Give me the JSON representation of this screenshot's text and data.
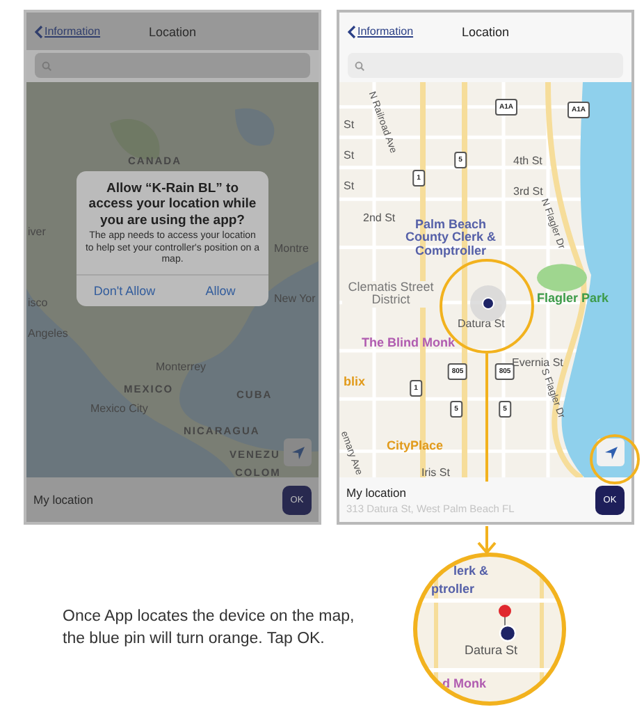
{
  "phones": [
    {
      "back_link": "Information",
      "title": "Location",
      "kind": "world",
      "map_labels": [
        {
          "text": "CANADA",
          "kind": "country"
        },
        {
          "text": "Montre",
          "kind": "city"
        },
        {
          "text": "New Yor",
          "kind": "city"
        },
        {
          "text": "iver",
          "kind": "city"
        },
        {
          "text": "isco",
          "kind": "city"
        },
        {
          "text": "Angeles",
          "kind": "city"
        },
        {
          "text": "Monterrey",
          "kind": "city"
        },
        {
          "text": "MEXICO",
          "kind": "country"
        },
        {
          "text": "Mexico City",
          "kind": "city"
        },
        {
          "text": "CUBA",
          "kind": "country"
        },
        {
          "text": "NICARAGUA",
          "kind": "country"
        },
        {
          "text": "VENEZU",
          "kind": "country"
        },
        {
          "text": "COLOM",
          "kind": "country"
        }
      ],
      "dialog": {
        "title": "Allow “K-Rain BL” to access your location while you are using the app?",
        "message": "The app needs to access your location to help set your controller's position on a map.",
        "buttons": [
          "Don't Allow",
          "Allow"
        ]
      },
      "footer": {
        "label": "My location",
        "ok": "OK"
      }
    },
    {
      "back_link": "Information",
      "title": "Location",
      "kind": "streets",
      "map_labels": [
        {
          "text": "N Railroad Ave",
          "kind": "street-vertical"
        },
        {
          "text": "St",
          "kind": "street"
        },
        {
          "text": "St",
          "kind": "street"
        },
        {
          "text": "St",
          "kind": "street"
        },
        {
          "text": "4th St",
          "kind": "street"
        },
        {
          "text": "3rd St",
          "kind": "street"
        },
        {
          "text": "2nd St",
          "kind": "street"
        },
        {
          "text": "N Flagler Dr",
          "kind": "street-vertical"
        },
        {
          "text": "Palm Beach County Clerk & Comptroller",
          "kind": "civic"
        },
        {
          "text": "Clematis Street District",
          "kind": "district"
        },
        {
          "text": "Flagler Park",
          "kind": "park"
        },
        {
          "text": "Datura St",
          "kind": "street"
        },
        {
          "text": "The Blind Monk",
          "kind": "food"
        },
        {
          "text": "Evernia St",
          "kind": "street"
        },
        {
          "text": "S Flagler Dr",
          "kind": "street-vertical"
        },
        {
          "text": "blix",
          "kind": "shop"
        },
        {
          "text": "CityPlace",
          "kind": "shop"
        },
        {
          "text": "Iris St",
          "kind": "street"
        },
        {
          "text": "emary Ave",
          "kind": "street-vertical"
        }
      ],
      "shields": [
        "A1A",
        "A1A",
        "5",
        "1",
        "1",
        "805",
        "805",
        "5",
        "5"
      ],
      "footer": {
        "label": "My location",
        "address": "313 Datura St, West Palm Beach FL",
        "ok": "OK"
      }
    }
  ],
  "caption": "Once App locates the device on the map, the blue pin will turn orange. Tap OK.",
  "zoom_inset": {
    "labels": [
      {
        "text": "lerk &",
        "kind": "civic"
      },
      {
        "text": "ptroller",
        "kind": "civic"
      },
      {
        "text": "Datura St",
        "kind": "street"
      },
      {
        "text": "d Monk",
        "kind": "food"
      }
    ]
  }
}
